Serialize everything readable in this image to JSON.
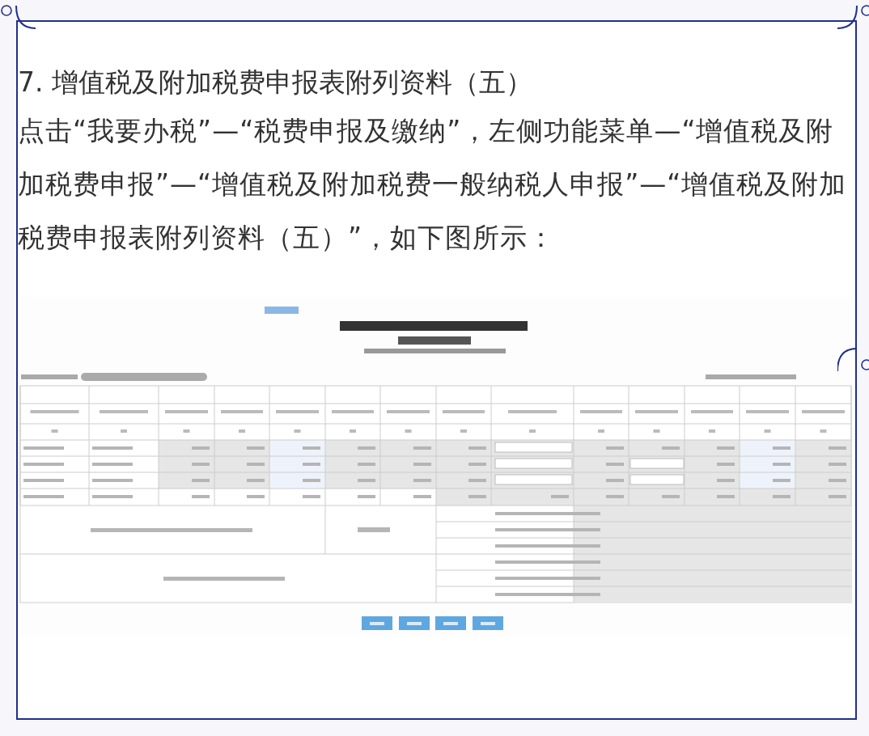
{
  "article": {
    "heading": "7. 增值税及附加税费申报表附列资料（五）",
    "paragraphs": [
      "点击“我要办税”—“税费申报及缴纳”，左侧功能菜单—“增值税及附加税费申报”—“增值税及附加税费一般纳税人申报”—“增值税及附加税费申报表附列资料（五）”，如下图所示："
    ]
  },
  "screenshot": {
    "kind": "form"
  }
}
